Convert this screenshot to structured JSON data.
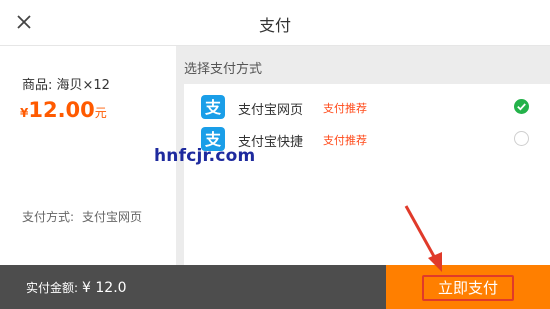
{
  "header": {
    "title": "支付",
    "close_icon": "close-icon"
  },
  "order": {
    "product": "商品: 海贝×12",
    "price_symbol": "¥",
    "price_value": "12.00",
    "price_unit": "元",
    "method_label": "支付方式:",
    "method_value": "支付宝网页"
  },
  "payment_section": {
    "title": "选择支付方式",
    "options": [
      {
        "name": "支付宝网页",
        "tag": "支付推荐",
        "selected": true,
        "icon": "alipay-icon"
      },
      {
        "name": "支付宝快捷",
        "tag": "支付推荐",
        "selected": false,
        "icon": "alipay-icon"
      }
    ]
  },
  "watermark": "hnfcjr.com",
  "footer": {
    "amount_label": "实付金额:",
    "amount_value": "¥ 12.0",
    "pay_button": "立即支付"
  },
  "colors": {
    "accent": "#ff7f00",
    "price": "#ff5a00",
    "alipay": "#1a9ee8",
    "check": "#24b24a",
    "highlight": "#e03a2a"
  }
}
